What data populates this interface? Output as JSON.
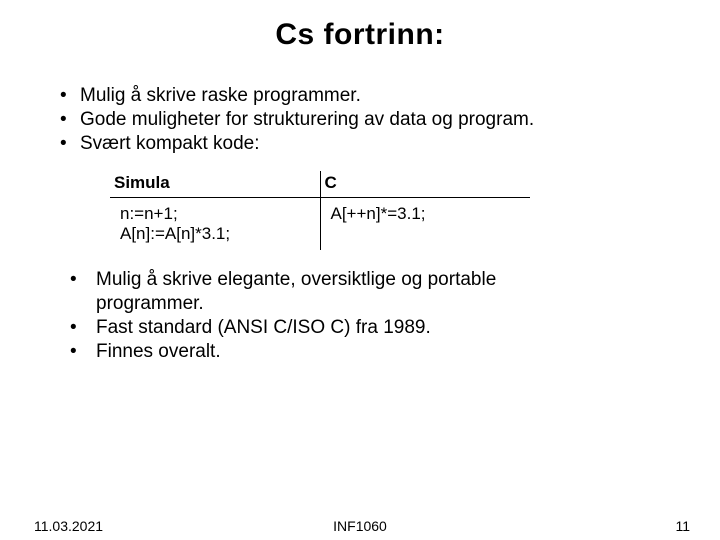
{
  "title": "Cs fortrinn:",
  "bullets_top": [
    "Mulig å skrive raske programmer.",
    "Gode muligheter for strukturering av data og program.",
    "Svært kompakt kode:"
  ],
  "table": {
    "headers": {
      "simula": "Simula",
      "c": "C"
    },
    "simula_code": "n:=n+1;\nA[n]:=A[n]*3.1;",
    "c_code": "A[++n]*=3.1;"
  },
  "bullets_bottom": [
    "Mulig å skrive elegante, oversiktlige og portable",
    "programmer.",
    "Fast standard (ANSI C/ISO C) fra 1989.",
    "Finnes overalt."
  ],
  "footer": {
    "date": "11.03.2021",
    "course": "INF1060",
    "page": "11"
  }
}
